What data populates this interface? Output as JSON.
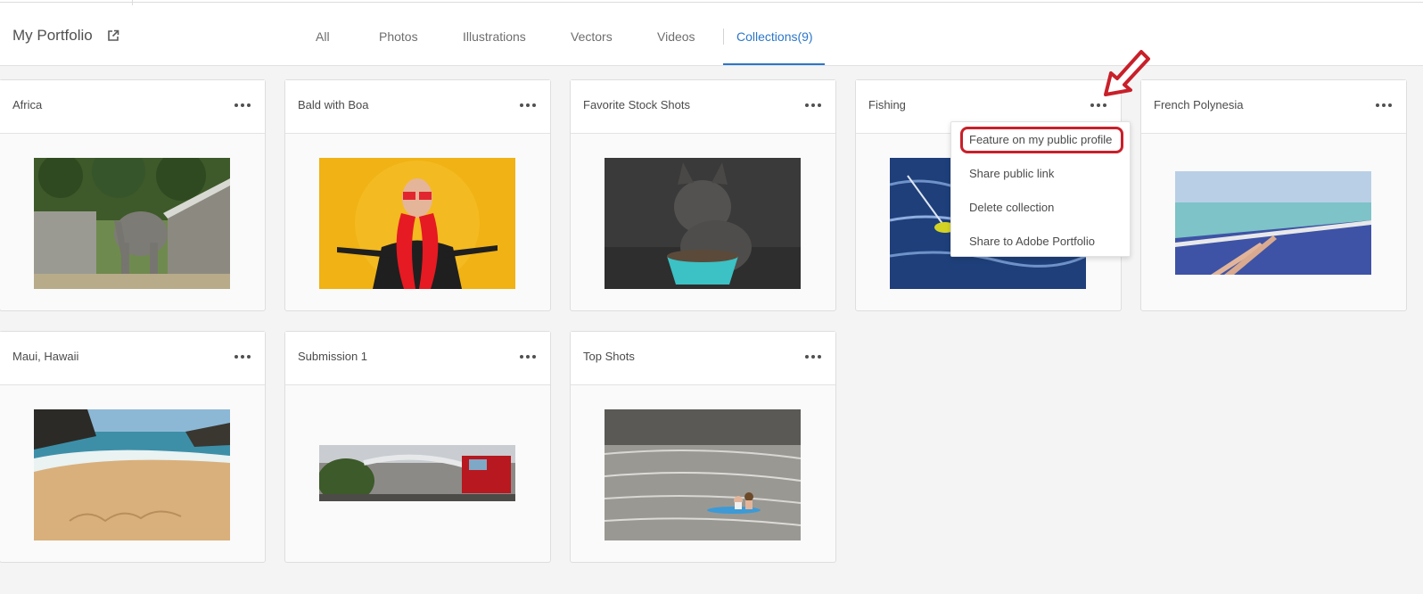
{
  "header": {
    "portfolio_label": "My Portfolio",
    "tabs": [
      {
        "label": "All"
      },
      {
        "label": "Photos"
      },
      {
        "label": "Illustrations"
      },
      {
        "label": "Vectors"
      },
      {
        "label": "Videos"
      },
      {
        "label": "Collections(9)",
        "active": true
      }
    ]
  },
  "collections": [
    {
      "title": "Africa",
      "thumb": "elephant-photo"
    },
    {
      "title": "Bald with Boa",
      "thumb": "man-with-boa-photo"
    },
    {
      "title": "Favorite Stock Shots",
      "thumb": "bulldog-photo"
    },
    {
      "title": "Fishing",
      "thumb": "fishing-photo"
    },
    {
      "title": "French Polynesia",
      "thumb": "boat-feet-photo"
    },
    {
      "title": "Maui, Hawaii",
      "thumb": "beach-relax-photo"
    },
    {
      "title": "Submission 1",
      "thumb": "fire-truck-photo"
    },
    {
      "title": "Top Shots",
      "thumb": "kayak-photo"
    }
  ],
  "context_menu": {
    "items": [
      {
        "label": "Feature on my public profile",
        "highlighted": true
      },
      {
        "label": "Share public link"
      },
      {
        "label": "Delete collection"
      },
      {
        "label": "Share to Adobe Portfolio"
      }
    ]
  },
  "colors": {
    "accent": "#2c76c9",
    "highlight": "#c8202a"
  }
}
